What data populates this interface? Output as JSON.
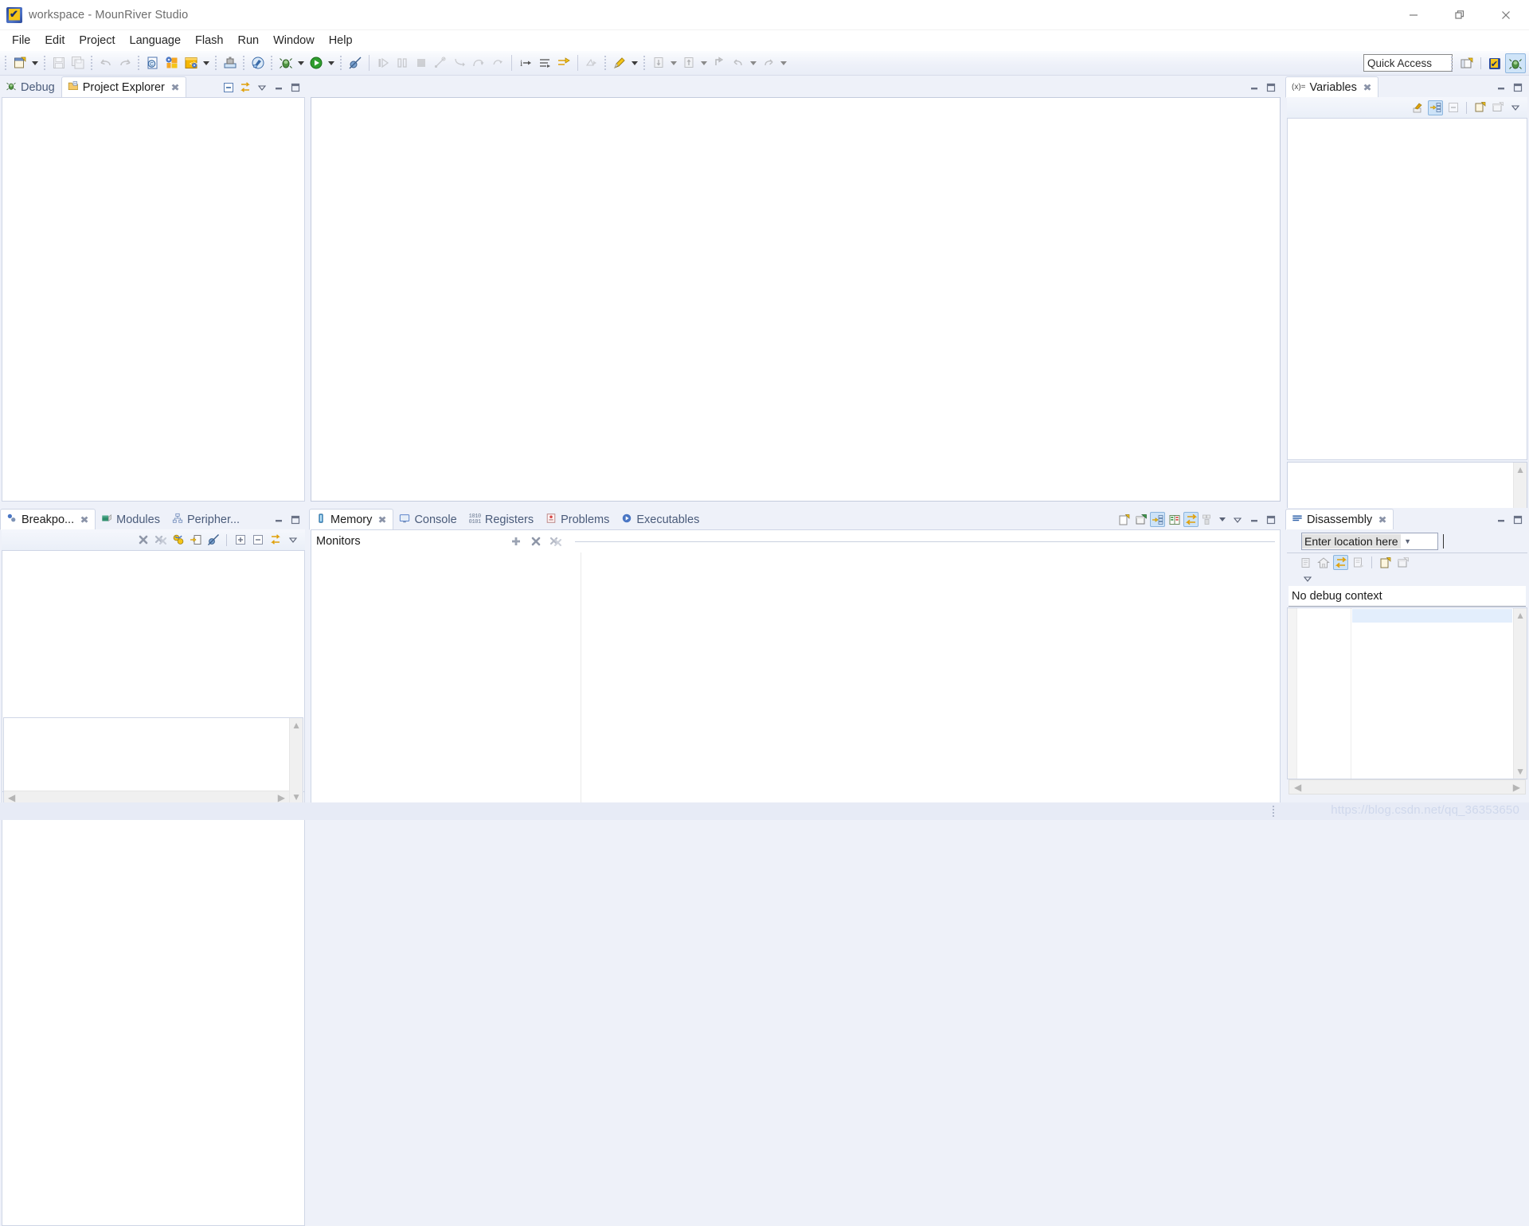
{
  "window": {
    "title": "workspace - MounRiver Studio",
    "app_icon": "mounriver-logo-icon",
    "controls": [
      {
        "name": "minimize-button",
        "glyph": "minimize-icon"
      },
      {
        "name": "restore-button",
        "glyph": "restore-icon"
      },
      {
        "name": "close-button",
        "glyph": "close-icon"
      }
    ]
  },
  "menubar": {
    "items": [
      "File",
      "Edit",
      "Project",
      "Language",
      "Flash",
      "Run",
      "Window",
      "Help"
    ]
  },
  "toolbar": {
    "quick_access": "Quick Access",
    "groups": [
      {
        "items": [
          {
            "name": "new-button",
            "icon": "new-file-icon",
            "dropdown": true,
            "enabled": true
          }
        ]
      },
      {
        "items": [
          {
            "name": "save-button",
            "icon": "save-icon",
            "enabled": false
          },
          {
            "name": "save-all-button",
            "icon": "save-all-icon",
            "enabled": false
          }
        ]
      },
      {
        "items": [
          {
            "name": "undo-button",
            "icon": "undo-icon",
            "enabled": false
          },
          {
            "name": "redo-button",
            "icon": "redo-icon",
            "enabled": false
          }
        ]
      },
      {
        "items": [
          {
            "name": "new-c-file-button",
            "icon": "c-file-icon",
            "enabled": true
          },
          {
            "name": "new-project-button",
            "icon": "new-project-icon",
            "enabled": true
          },
          {
            "name": "new-source-button",
            "icon": "source-code-icon",
            "dropdown": true,
            "enabled": true
          }
        ]
      },
      {
        "items": [
          {
            "name": "download-button",
            "icon": "download-tool-icon",
            "enabled": true
          }
        ]
      },
      {
        "items": [
          {
            "name": "build-button",
            "icon": "build-hammer-icon",
            "enabled": true
          }
        ]
      },
      {
        "items": [
          {
            "name": "debug-button",
            "icon": "debug-bug-icon",
            "dropdown": true,
            "enabled": true
          },
          {
            "name": "run-button",
            "icon": "run-play-icon",
            "dropdown": true,
            "enabled": true
          }
        ]
      },
      {
        "items": [
          {
            "name": "skip-breakpoints-button",
            "icon": "skip-breakpoints-icon",
            "enabled": true
          }
        ]
      },
      {
        "items": [
          {
            "name": "resume-button",
            "icon": "resume-icon",
            "enabled": false
          },
          {
            "name": "suspend-button",
            "icon": "suspend-icon",
            "enabled": false
          },
          {
            "name": "terminate-button",
            "icon": "terminate-stop-icon",
            "enabled": false
          },
          {
            "name": "disconnect-button",
            "icon": "disconnect-icon",
            "enabled": false
          },
          {
            "name": "step-into-button",
            "icon": "step-into-icon",
            "enabled": false
          },
          {
            "name": "step-over-button",
            "icon": "step-over-icon",
            "enabled": false
          },
          {
            "name": "step-return-button",
            "icon": "step-return-icon",
            "enabled": false
          }
        ]
      },
      {
        "items": [
          {
            "name": "instruction-stepping-button",
            "icon": "instruction-stepping-icon",
            "enabled": true
          },
          {
            "name": "drop-to-frame-button",
            "icon": "drop-to-frame-icon",
            "enabled": true
          },
          {
            "name": "toggle-step-filters-button",
            "icon": "step-filters-icon",
            "enabled": true
          }
        ]
      },
      {
        "items": [
          {
            "name": "run-last-tool-button",
            "icon": "external-tools-icon",
            "enabled": false
          }
        ]
      },
      {
        "items": [
          {
            "name": "search-marker-button",
            "icon": "pencil-marker-icon",
            "dropdown": true,
            "enabled": true
          }
        ]
      },
      {
        "items": [
          {
            "name": "next-annotation-button",
            "icon": "next-annotation-icon",
            "dropdown": true,
            "enabled": false
          }
        ]
      },
      {
        "items": [
          {
            "name": "previous-annotation-button",
            "icon": "previous-annotation-icon",
            "dropdown": true,
            "enabled": false
          }
        ]
      },
      {
        "items": [
          {
            "name": "last-edit-location-button",
            "icon": "last-edit-location-icon",
            "enabled": false
          },
          {
            "name": "back-button",
            "icon": "back-arrow-icon",
            "dropdown": true,
            "enabled": false
          },
          {
            "name": "forward-button",
            "icon": "forward-arrow-icon",
            "dropdown": true,
            "enabled": false
          }
        ]
      }
    ],
    "right_buttons": [
      {
        "name": "open-perspective-button",
        "icon": "open-perspective-icon",
        "active": false
      },
      {
        "name": "perspective-mounriver-button",
        "icon": "mounriver-perspective-icon",
        "active": false
      },
      {
        "name": "perspective-debug-button",
        "icon": "debug-perspective-icon",
        "active": true
      }
    ]
  },
  "panels": {
    "explorer": {
      "tabs": [
        {
          "name": "tab-debug",
          "label": "Debug",
          "icon": "debug-bug-icon",
          "active": false,
          "closable": false
        },
        {
          "name": "tab-project-explorer",
          "label": "Project Explorer",
          "icon": "project-folder-icon",
          "active": true,
          "closable": true
        }
      ],
      "actions": [
        {
          "name": "collapse-all-button",
          "icon": "collapse-all-icon"
        },
        {
          "name": "link-with-editor-button",
          "icon": "link-editor-icon"
        },
        {
          "name": "view-menu-button",
          "icon": "view-menu-icon"
        },
        {
          "name": "minimize-view-button",
          "icon": "minimize-view-icon"
        },
        {
          "name": "maximize-view-button",
          "icon": "maximize-view-icon"
        }
      ],
      "content": ""
    },
    "editor": {
      "actions": [
        {
          "name": "minimize-editor-button",
          "icon": "minimize-view-icon"
        },
        {
          "name": "maximize-editor-button",
          "icon": "maximize-view-icon"
        }
      ],
      "content": ""
    },
    "variables": {
      "tabs": [
        {
          "name": "tab-variables",
          "label": "Variables",
          "icon": "variables-icon",
          "active": true,
          "closable": true
        }
      ],
      "actions": [
        {
          "name": "minimize-view-button",
          "icon": "minimize-view-icon"
        },
        {
          "name": "maximize-view-button",
          "icon": "maximize-view-icon"
        }
      ],
      "toolbar": [
        {
          "name": "collapse-variables-button",
          "icon": "collapse-variables-icon",
          "selected": false
        },
        {
          "name": "show-type-names-button",
          "icon": "show-type-names-icon",
          "selected": true
        },
        {
          "name": "collapse-all-button",
          "icon": "collapse-all-icon",
          "selected": false
        },
        {
          "name": "add-watch-button",
          "icon": "new-watch-icon",
          "selected": false
        },
        {
          "name": "detail-pane-button",
          "icon": "detail-pane-icon",
          "selected": false
        },
        {
          "name": "view-menu-button",
          "icon": "view-menu-icon",
          "selected": false
        }
      ],
      "content": ""
    },
    "breakpoints": {
      "tabs": [
        {
          "name": "tab-breakpoints",
          "label": "Breakpo...",
          "icon": "breakpoints-icon",
          "active": true,
          "closable": true
        },
        {
          "name": "tab-modules",
          "label": "Modules",
          "icon": "modules-icon",
          "active": false,
          "closable": false
        },
        {
          "name": "tab-peripherals",
          "label": "Peripher...",
          "icon": "peripherals-icon",
          "active": false,
          "closable": false
        }
      ],
      "actions": [
        {
          "name": "minimize-view-button",
          "icon": "minimize-view-icon"
        },
        {
          "name": "maximize-view-button",
          "icon": "maximize-view-icon"
        }
      ],
      "toolbar": [
        {
          "name": "remove-breakpoint-button",
          "icon": "remove-icon"
        },
        {
          "name": "remove-all-breakpoints-button",
          "icon": "remove-all-icon"
        },
        {
          "name": "breakpoint-types-button",
          "icon": "breakpoint-types-icon"
        },
        {
          "name": "goto-file-button",
          "icon": "goto-file-icon"
        },
        {
          "name": "skip-all-breakpoints-button",
          "icon": "skip-breakpoints-icon"
        },
        {
          "name": "expand-all-button",
          "icon": "expand-all-icon"
        },
        {
          "name": "collapse-all-button",
          "icon": "collapse-all-icon"
        },
        {
          "name": "link-with-debug-view-button",
          "icon": "link-editor-icon"
        },
        {
          "name": "view-menu-button",
          "icon": "view-menu-icon"
        }
      ],
      "content": ""
    },
    "memory": {
      "tabs": [
        {
          "name": "tab-memory",
          "label": "Memory",
          "icon": "memory-icon",
          "active": true,
          "closable": true
        },
        {
          "name": "tab-console",
          "label": "Console",
          "icon": "console-icon",
          "active": false,
          "closable": false
        },
        {
          "name": "tab-registers",
          "label": "Registers",
          "icon": "registers-icon",
          "active": false,
          "closable": false
        },
        {
          "name": "tab-problems",
          "label": "Problems",
          "icon": "problems-icon",
          "active": false,
          "closable": false
        },
        {
          "name": "tab-executables",
          "label": "Executables",
          "icon": "executables-icon",
          "active": false,
          "closable": false
        }
      ],
      "actions": [
        {
          "name": "new-memory-view-button",
          "icon": "new-view-icon",
          "selected": false
        },
        {
          "name": "pin-memory-view-button",
          "icon": "pin-view-icon",
          "selected": false
        },
        {
          "name": "link-memory-rendering-button",
          "icon": "link-rendering-icon",
          "selected": true
        },
        {
          "name": "toggle-split-pane-button",
          "icon": "split-pane-icon",
          "selected": false
        },
        {
          "name": "toggle-memory-monitors-button",
          "icon": "toggle-monitors-icon",
          "selected": true
        },
        {
          "name": "memory-layout-button",
          "icon": "layout-icon",
          "selected": false,
          "dropdown": true
        },
        {
          "name": "view-menu-button",
          "icon": "view-menu-icon",
          "selected": false
        },
        {
          "name": "minimize-view-button",
          "icon": "minimize-view-icon",
          "selected": false
        },
        {
          "name": "maximize-view-button",
          "icon": "maximize-view-icon",
          "selected": false
        }
      ],
      "monitors_label": "Monitors",
      "monitor_actions": [
        {
          "name": "add-memory-monitor-button",
          "icon": "add-plus-icon"
        },
        {
          "name": "remove-memory-monitor-button",
          "icon": "remove-icon"
        },
        {
          "name": "remove-all-memory-monitors-button",
          "icon": "remove-all-icon"
        }
      ],
      "content": ""
    },
    "disassembly": {
      "tabs": [
        {
          "name": "tab-disassembly",
          "label": "Disassembly",
          "icon": "disassembly-icon",
          "active": true,
          "closable": true
        }
      ],
      "actions": [
        {
          "name": "minimize-view-button",
          "icon": "minimize-view-icon"
        },
        {
          "name": "maximize-view-button",
          "icon": "maximize-view-icon"
        }
      ],
      "location_input": {
        "name": "disassembly-location-input",
        "value": "Enter location here",
        "placeholder": "Enter location here"
      },
      "toolbar": [
        {
          "name": "show-address-column-button",
          "icon": "address-column-icon",
          "selected": false
        },
        {
          "name": "home-button",
          "icon": "home-icon",
          "selected": false
        },
        {
          "name": "link-with-active-debug-button",
          "icon": "link-debug-icon",
          "selected": true
        },
        {
          "name": "show-source-button",
          "icon": "show-source-icon",
          "selected": false
        },
        {
          "name": "new-view-button",
          "icon": "new-view-icon",
          "selected": false
        },
        {
          "name": "pin-view-button",
          "icon": "pin-view-icon",
          "selected": false
        }
      ],
      "menu_button": {
        "name": "disassembly-view-menu-button",
        "icon": "view-menu-icon"
      },
      "status_text": "No debug context",
      "content": ""
    }
  },
  "statusbar": {
    "watermark": "https://blog.csdn.net/qq_36353650"
  }
}
